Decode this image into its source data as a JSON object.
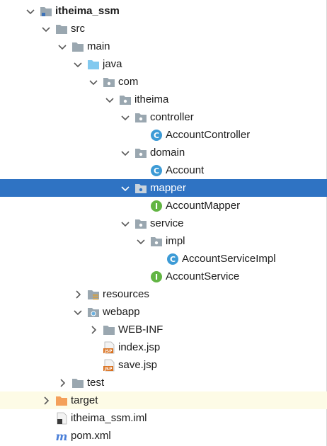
{
  "tree": {
    "root": {
      "label": "itheima_ssm"
    },
    "src": {
      "label": "src"
    },
    "main": {
      "label": "main"
    },
    "java": {
      "label": "java"
    },
    "com": {
      "label": "com"
    },
    "itheima": {
      "label": "itheima"
    },
    "controller": {
      "label": "controller"
    },
    "account_controller": {
      "label": "AccountController",
      "badge": "C"
    },
    "domain": {
      "label": "domain"
    },
    "account": {
      "label": "Account",
      "badge": "C"
    },
    "mapper": {
      "label": "mapper"
    },
    "account_mapper": {
      "label": "AccountMapper",
      "badge": "I"
    },
    "service": {
      "label": "service"
    },
    "impl": {
      "label": "impl"
    },
    "account_service_impl": {
      "label": "AccountServiceImpl",
      "badge": "C"
    },
    "account_service": {
      "label": "AccountService",
      "badge": "I"
    },
    "resources": {
      "label": "resources"
    },
    "webapp": {
      "label": "webapp"
    },
    "web_inf": {
      "label": "WEB-INF"
    },
    "index_jsp": {
      "label": "index.jsp",
      "badge": "JSP"
    },
    "save_jsp": {
      "label": "save.jsp",
      "badge": "JSP"
    },
    "test": {
      "label": "test"
    },
    "target": {
      "label": "target"
    },
    "iml": {
      "label": "itheima_ssm.iml"
    },
    "pom": {
      "label": "pom.xml",
      "badge": "m"
    }
  },
  "icons": {
    "folder": "folder-icon",
    "package": "package-icon",
    "class": "class-icon",
    "interface": "interface-icon",
    "jsp": "jsp-file-icon",
    "maven": "maven-icon",
    "module": "module-folder-icon",
    "excluded": "excluded-folder-icon",
    "web": "web-folder-icon",
    "resources": "resources-folder-icon",
    "iml": "iml-file-icon"
  },
  "colors": {
    "selection": "#2f73c3",
    "class_badge": "#3d9bd6",
    "interface_badge": "#62b543",
    "folder": "#9aa7b0",
    "source_folder": "#82c9ef",
    "excluded_folder": "#f4a05a",
    "jsp": "#d9711f",
    "maven": "#4a7fd8"
  }
}
